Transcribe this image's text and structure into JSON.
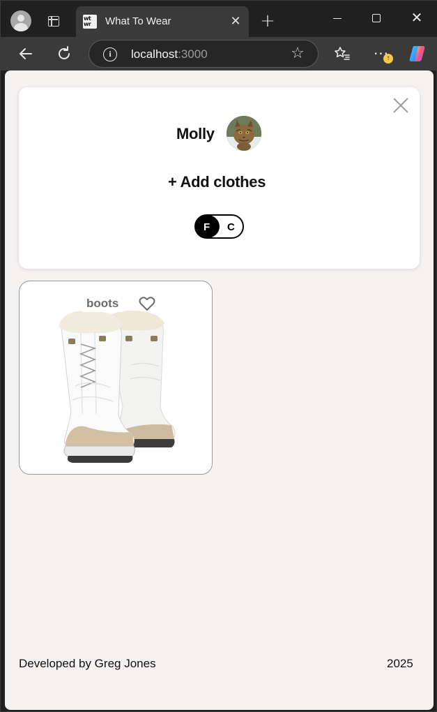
{
  "browser": {
    "tab_title": "What To Wear",
    "favicon_text": "wt wr",
    "url_host": "localhost",
    "url_port": ":3000",
    "update_badge": "↑"
  },
  "profile": {
    "name": "Molly",
    "add_clothes_label": "+ Add clothes",
    "toggle": {
      "left": "F",
      "right": "C",
      "selected": "F"
    }
  },
  "items": [
    {
      "name": "boots",
      "liked": false
    }
  ],
  "footer": {
    "credit": "Developed by Greg Jones",
    "year": "2025"
  }
}
